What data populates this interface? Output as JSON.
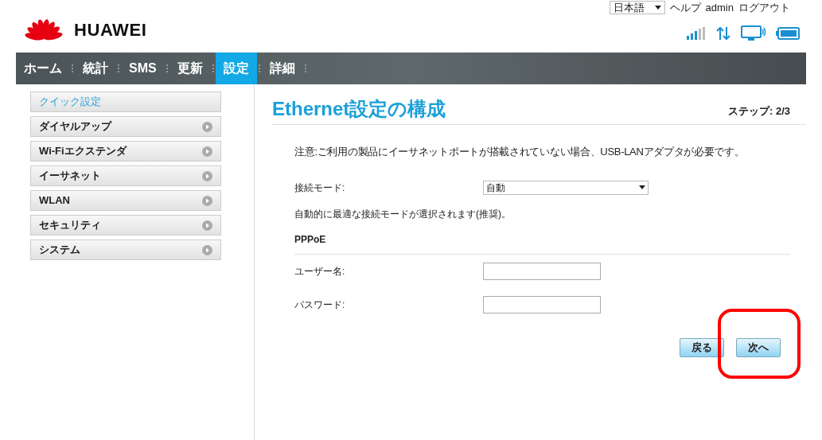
{
  "header": {
    "brand": "HUAWEI",
    "language": {
      "value": "日本語"
    },
    "links": [
      "ヘルプ",
      "admin",
      "ログアウト"
    ]
  },
  "nav": [
    {
      "label": "ホーム",
      "selected": false
    },
    {
      "label": "統計",
      "selected": false
    },
    {
      "label": "SMS",
      "selected": false
    },
    {
      "label": "更新",
      "selected": false
    },
    {
      "label": "設定",
      "selected": true
    },
    {
      "label": "詳細",
      "selected": false
    }
  ],
  "sidebar": {
    "items": [
      {
        "label": "クイック設定",
        "selected": true
      },
      {
        "label": "ダイヤルアップ",
        "selected": false
      },
      {
        "label": "Wi-Fiエクステンダ",
        "selected": false
      },
      {
        "label": "イーサネット",
        "selected": false
      },
      {
        "label": "WLAN",
        "selected": false
      },
      {
        "label": "セキュリティ",
        "selected": false
      },
      {
        "label": "システム",
        "selected": false
      }
    ]
  },
  "main": {
    "title": "Ethernet設定の構成",
    "step": "ステップ: 2/3",
    "note": "注意:ご利用の製品にイーサネットポートが搭載されていない場合、USB-LANアダプタが必要です。",
    "mode": {
      "label": "接続モード:",
      "value": "自動"
    },
    "hint": "自動的に最適な接続モードが選択されます(推奨)。",
    "section": "PPPoE",
    "fields": [
      {
        "label": "ユーザー名:"
      },
      {
        "label": "パスワード:"
      }
    ],
    "buttons": [
      "戻る",
      "次へ"
    ]
  }
}
